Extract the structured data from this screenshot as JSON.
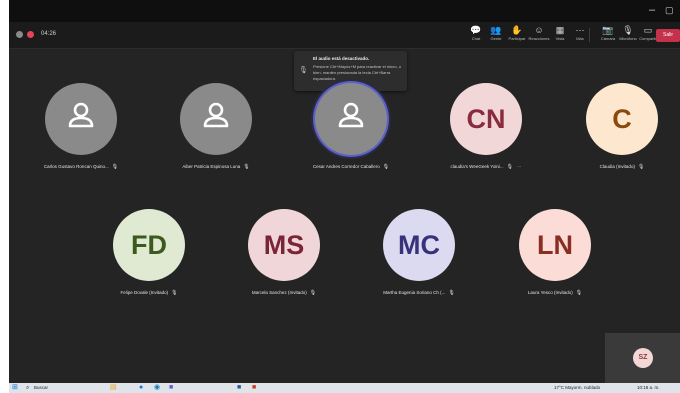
{
  "window": {
    "minimize_glyph": "–",
    "maximize_glyph": "▢"
  },
  "meeting": {
    "timer": "04:26",
    "recording_color": "#e2445c",
    "buttons": [
      {
        "icon": "chat-icon",
        "glyph": "💬",
        "label": "Chat"
      },
      {
        "icon": "people-icon",
        "glyph": "👥",
        "label": "Gente"
      },
      {
        "icon": "raise-hand-icon",
        "glyph": "✋",
        "label": "Participar"
      },
      {
        "icon": "reactions-icon",
        "glyph": "☺",
        "label": "Reacciones"
      },
      {
        "icon": "view-icon",
        "glyph": "▦",
        "label": "Vista"
      },
      {
        "icon": "more-icon",
        "glyph": "⋯",
        "label": "Más"
      },
      {
        "icon": "camera-icon",
        "glyph": "📷",
        "label": "Cámara"
      },
      {
        "icon": "mic-icon",
        "glyph": "🎙",
        "label": "Micrófono"
      },
      {
        "icon": "share-icon",
        "glyph": "▭",
        "label": "Compartir"
      }
    ],
    "leave_label": "Salir",
    "leave_color": "#c4314b"
  },
  "notice": {
    "title": "El audio está desactivado.",
    "body": "Presione Ctrl+Mayús+M para reactivar el micro, o bien, mantén presionada la tecla Ctrl+Barra espaciadora."
  },
  "participants": [
    {
      "name": "Carlos Gustavo Roncan Quino...",
      "initials": "",
      "bg": "#8a8a8a",
      "fg": "#ffffff",
      "generic": true,
      "speaking": false,
      "more": false
    },
    {
      "name": "Aiber Patricia Espinosa Luna",
      "initials": "",
      "bg": "#8a8a8a",
      "fg": "#ffffff",
      "generic": true,
      "speaking": false,
      "more": false
    },
    {
      "name": "Cesar Andres Corredor Caballero",
      "initials": "",
      "bg": "#8a8a8a",
      "fg": "#ffffff",
      "generic": true,
      "speaking": true,
      "more": false
    },
    {
      "name": "claudia's WeeGeek Yoini...",
      "initials": "CN",
      "bg": "#f2d7d9",
      "fg": "#8b2b3e",
      "generic": false,
      "speaking": false,
      "more": true
    },
    {
      "name": "Claudia (Invitado)",
      "initials": "C",
      "bg": "#fde7cf",
      "fg": "#8a4a0c",
      "generic": false,
      "speaking": false,
      "more": false
    },
    {
      "name": "Felipe Dovale (Invitado)",
      "initials": "FD",
      "bg": "#e0ead2",
      "fg": "#3c5a1e",
      "generic": false,
      "speaking": false,
      "more": false
    },
    {
      "name": "Marcela Sanchez (Invitado)",
      "initials": "MS",
      "bg": "#f0d6d8",
      "fg": "#7a2535",
      "generic": false,
      "speaking": false,
      "more": false
    },
    {
      "name": "Martha Eugenia Soriano Ch (...",
      "initials": "MC",
      "bg": "#dcdaf0",
      "fg": "#37327a",
      "generic": false,
      "speaking": false,
      "more": false
    },
    {
      "name": "Laura Yesco (Invitado)",
      "initials": "LN",
      "bg": "#fbdcd6",
      "fg": "#8a2d22",
      "generic": false,
      "speaking": false,
      "more": false
    }
  ],
  "self_view": {
    "initials": "SZ"
  },
  "taskbar": {
    "search_placeholder": "Buscar",
    "apps": [
      {
        "icon": "file-explorer-icon",
        "glyph": "▤",
        "color": "#e8a317"
      },
      {
        "icon": "chrome-icon",
        "glyph": "●",
        "color": "#1a73e8"
      },
      {
        "icon": "edge-icon",
        "glyph": "◉",
        "color": "#0a7cbe"
      },
      {
        "icon": "teams-icon",
        "glyph": "■",
        "color": "#5b5fc7"
      },
      {
        "icon": "word-icon",
        "glyph": "■",
        "color": "#2b579a"
      },
      {
        "icon": "powerpoint-icon",
        "glyph": "■",
        "color": "#c43e1c"
      }
    ],
    "weather": "17°C Mayorm. nublado",
    "time": "10:18 a. m."
  }
}
